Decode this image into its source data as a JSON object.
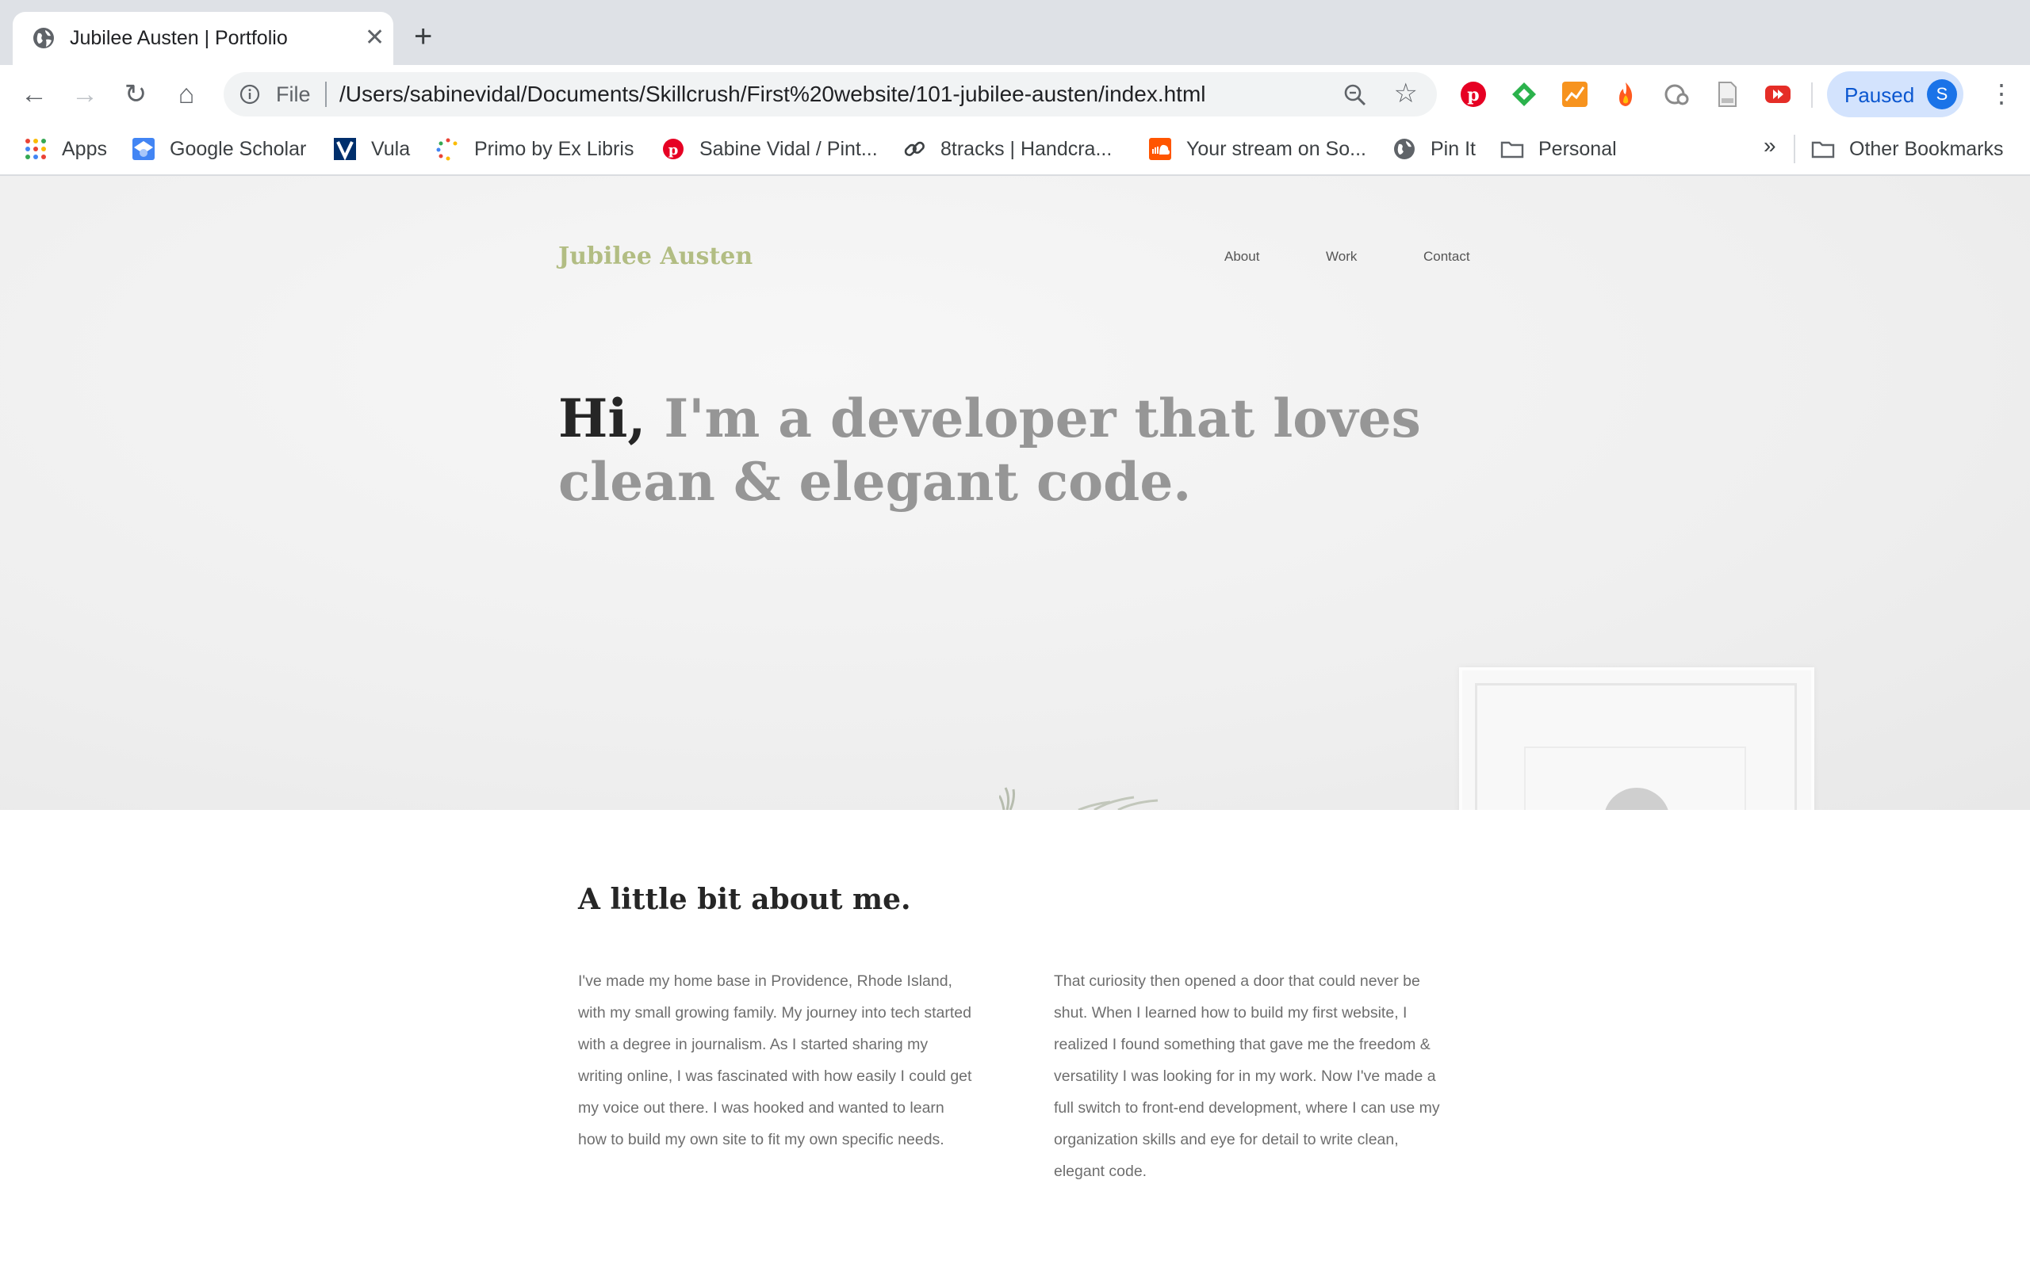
{
  "browser": {
    "tab": {
      "title": "Jubilee Austen | Portfolio",
      "close": "✕",
      "new_tab": "+"
    },
    "nav": {
      "back": "←",
      "forward": "→",
      "reload": "↻",
      "home": "⌂"
    },
    "omnibox": {
      "scheme_label": "File",
      "url": "/Users/sabinevidal/Documents/Skillcrush/First%20website/101-jubilee-austen/index.html",
      "star": "☆"
    },
    "extensions": [
      {
        "name": "pinterest-extension-icon",
        "color": "#e60023"
      },
      {
        "name": "feedly-extension-icon",
        "color": "#2bb24c"
      },
      {
        "name": "analytics-extension-icon",
        "color": "#f7931e"
      },
      {
        "name": "fire-extension-icon",
        "color": "#ff5a1f"
      },
      {
        "name": "grammar-extension-icon",
        "color": "#8a8a8a"
      },
      {
        "name": "document-extension-icon",
        "color": "#9e9e9e"
      },
      {
        "name": "youtube-extension-icon",
        "color": "#e52d27"
      }
    ],
    "profile": {
      "status": "Paused",
      "initial": "S"
    },
    "menu": "⋮",
    "bookmarks": [
      {
        "label": "Apps"
      },
      {
        "label": "Google Scholar"
      },
      {
        "label": "Vula"
      },
      {
        "label": "Primo by Ex Libris"
      },
      {
        "label": "Sabine Vidal / Pint..."
      },
      {
        "label": "8tracks | Handcra..."
      },
      {
        "label": "Your stream on So..."
      },
      {
        "label": "Pin It"
      },
      {
        "label": "Personal"
      }
    ],
    "bookmarks_overflow": "»",
    "other_bookmarks": "Other Bookmarks"
  },
  "site": {
    "logo": "Jubilee Austen",
    "nav": [
      "About",
      "Work",
      "Contact"
    ],
    "headline_hi": "Hi,",
    "headline_rest": " I'm a developer that loves clean & elegant code.",
    "colors": {
      "logo": "#b2bd83",
      "headline_accent": "#262626",
      "headline": "#969696"
    },
    "about": {
      "heading": "A little bit about me.",
      "paragraphs": [
        "I've made my home base in Providence, Rhode Island, with my small growing family. My journey into tech started with a degree in journalism. As I started sharing my writing online, I was fascinated with how easily I could get my voice out there. I was hooked and wanted to learn how to build my own site to fit my own specific needs.",
        "That curiosity then opened a door that could never be shut. When I learned how to build my first website, I realized I found something that gave me the freedom & versatility I was looking for in my work. Now I've made a full switch to front-end development, where I can use my organization skills and eye for detail to write clean, elegant code."
      ]
    }
  }
}
